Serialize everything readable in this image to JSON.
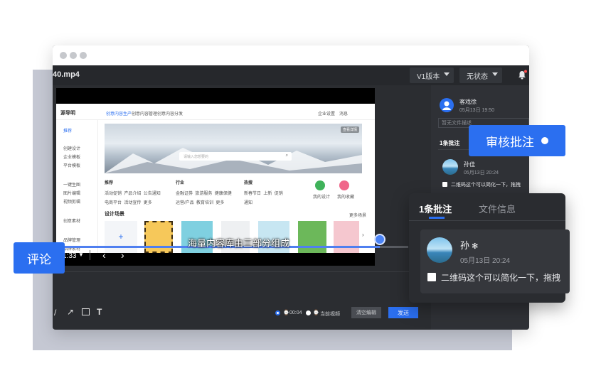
{
  "app": {
    "filename": "40.mp4",
    "version_select": "V1版本",
    "status_select": "无状态"
  },
  "website": {
    "logo": "源导明",
    "nav": [
      "创意内容生产",
      "创意内容管理",
      "创意内容分发"
    ],
    "header_right": [
      "企业设置",
      "消息"
    ],
    "sidebar": [
      "推荐",
      "创建设计",
      "企业模板",
      "平台模板",
      "一键生图",
      "图片编辑",
      "视频剪辑",
      "创意素材",
      "品牌管理",
      "品牌素材"
    ],
    "search_placeholder": "请输入您想要的",
    "banner_tag": "查看详情",
    "feature_cols": [
      {
        "title": "推荐",
        "items": [
          "活动促销",
          "产品介绍",
          "公告通知",
          "电商平台",
          "活动宣传",
          "更多"
        ]
      },
      {
        "title": "行业",
        "items": [
          "金融证券",
          "旅游服务",
          "健康保健",
          "运营/产品",
          "教育培训",
          "更多"
        ]
      },
      {
        "title": "热搜",
        "items": [
          "新春节日",
          "上新",
          "促销",
          "通知"
        ]
      }
    ],
    "quick_actions": [
      "我的设计",
      "我的收藏"
    ],
    "design_section": "设计场景",
    "design_more": "更多场景"
  },
  "player": {
    "subtitle": "海量内容库由三部分组成",
    "time": "1:33",
    "play_mode_1": "00:04",
    "play_mode_2": "当前视频",
    "clear_button": "清空编辑",
    "send_button": "发送"
  },
  "right_panel": {
    "user_name": "客戏徐",
    "user_date": "05月13日 19:50",
    "file_desc_placeholder": "暂无文件描述",
    "tab_comments": "1条批注",
    "comment_user": "孙佳",
    "comment_date": "05月13日 20:24",
    "comment_text": "二维码这个可以简化一下，拖拽"
  },
  "popup": {
    "tab_comments": "1条批注",
    "tab_fileinfo": "文件信息",
    "comment_user": "孙",
    "comment_date": "05月13日 20:24",
    "comment_text": "二维码这个可以简化一下，拖拽"
  },
  "callouts": {
    "review": "审核批注",
    "comment": "评论"
  },
  "colors": {
    "accent": "#2b6ff0",
    "dark_bg": "#2b2d31",
    "backdrop": "#c5c8d3"
  }
}
